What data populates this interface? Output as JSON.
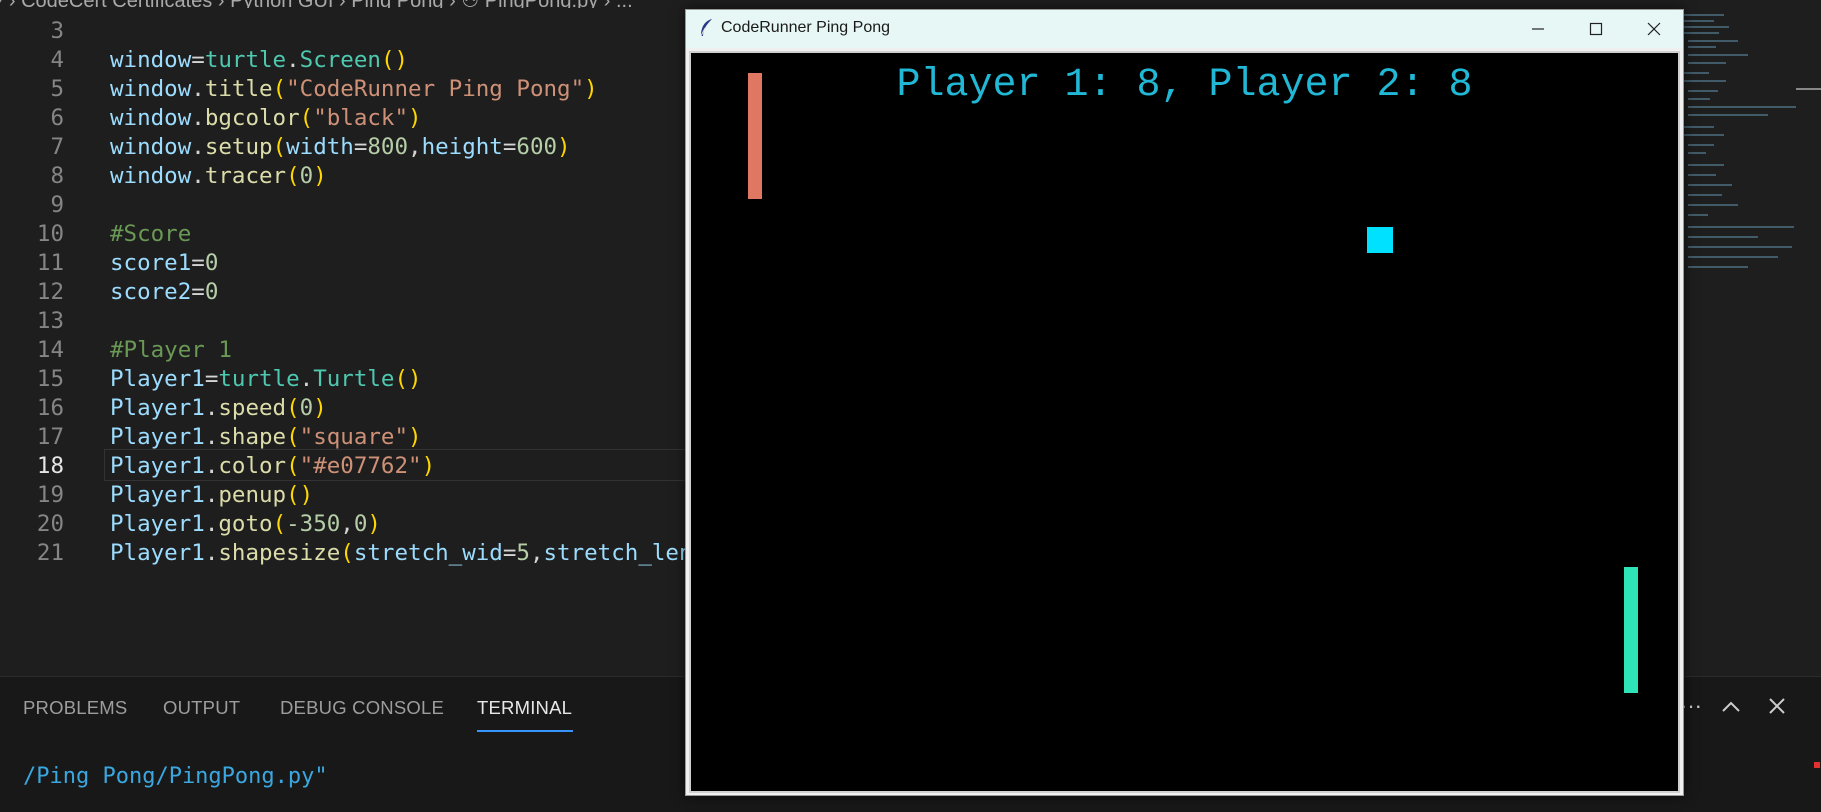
{
  "breadcrumb": "⁄ › CodeCert Certificates › Python GUI › Ping Pong › ⚇ PingPong.py › ...",
  "editor": {
    "lines": [
      {
        "num": "3"
      },
      {
        "num": "4"
      },
      {
        "num": "5"
      },
      {
        "num": "6"
      },
      {
        "num": "7"
      },
      {
        "num": "8"
      },
      {
        "num": "9"
      },
      {
        "num": "10"
      },
      {
        "num": "11"
      },
      {
        "num": "12"
      },
      {
        "num": "13"
      },
      {
        "num": "14"
      },
      {
        "num": "15"
      },
      {
        "num": "16"
      },
      {
        "num": "17"
      },
      {
        "num": "18"
      },
      {
        "num": "19"
      },
      {
        "num": "20"
      },
      {
        "num": "21"
      }
    ],
    "current_line": "18"
  },
  "panel": {
    "tabs": [
      "PROBLEMS",
      "OUTPUT",
      "DEBUG CONSOLE",
      "TERMINAL"
    ],
    "active_tab": "TERMINAL",
    "terminal_text": "/Ping Pong/PingPong.py\"",
    "more_label": "···",
    "maximize_icon": "chevron-up-icon",
    "close_icon": "close-icon"
  },
  "game_window": {
    "title": "CodeRunner Ping Pong",
    "score_text": "Player 1: 8, Player 2: 8",
    "player1_color": "#e07762",
    "player2_color": "#2ee3b5",
    "ball_color": "#00e1ff",
    "background": "#000000"
  },
  "colors": {
    "editor_bg": "#1e1e1e",
    "panel_bg": "#181818",
    "accent": "#3794ff"
  }
}
